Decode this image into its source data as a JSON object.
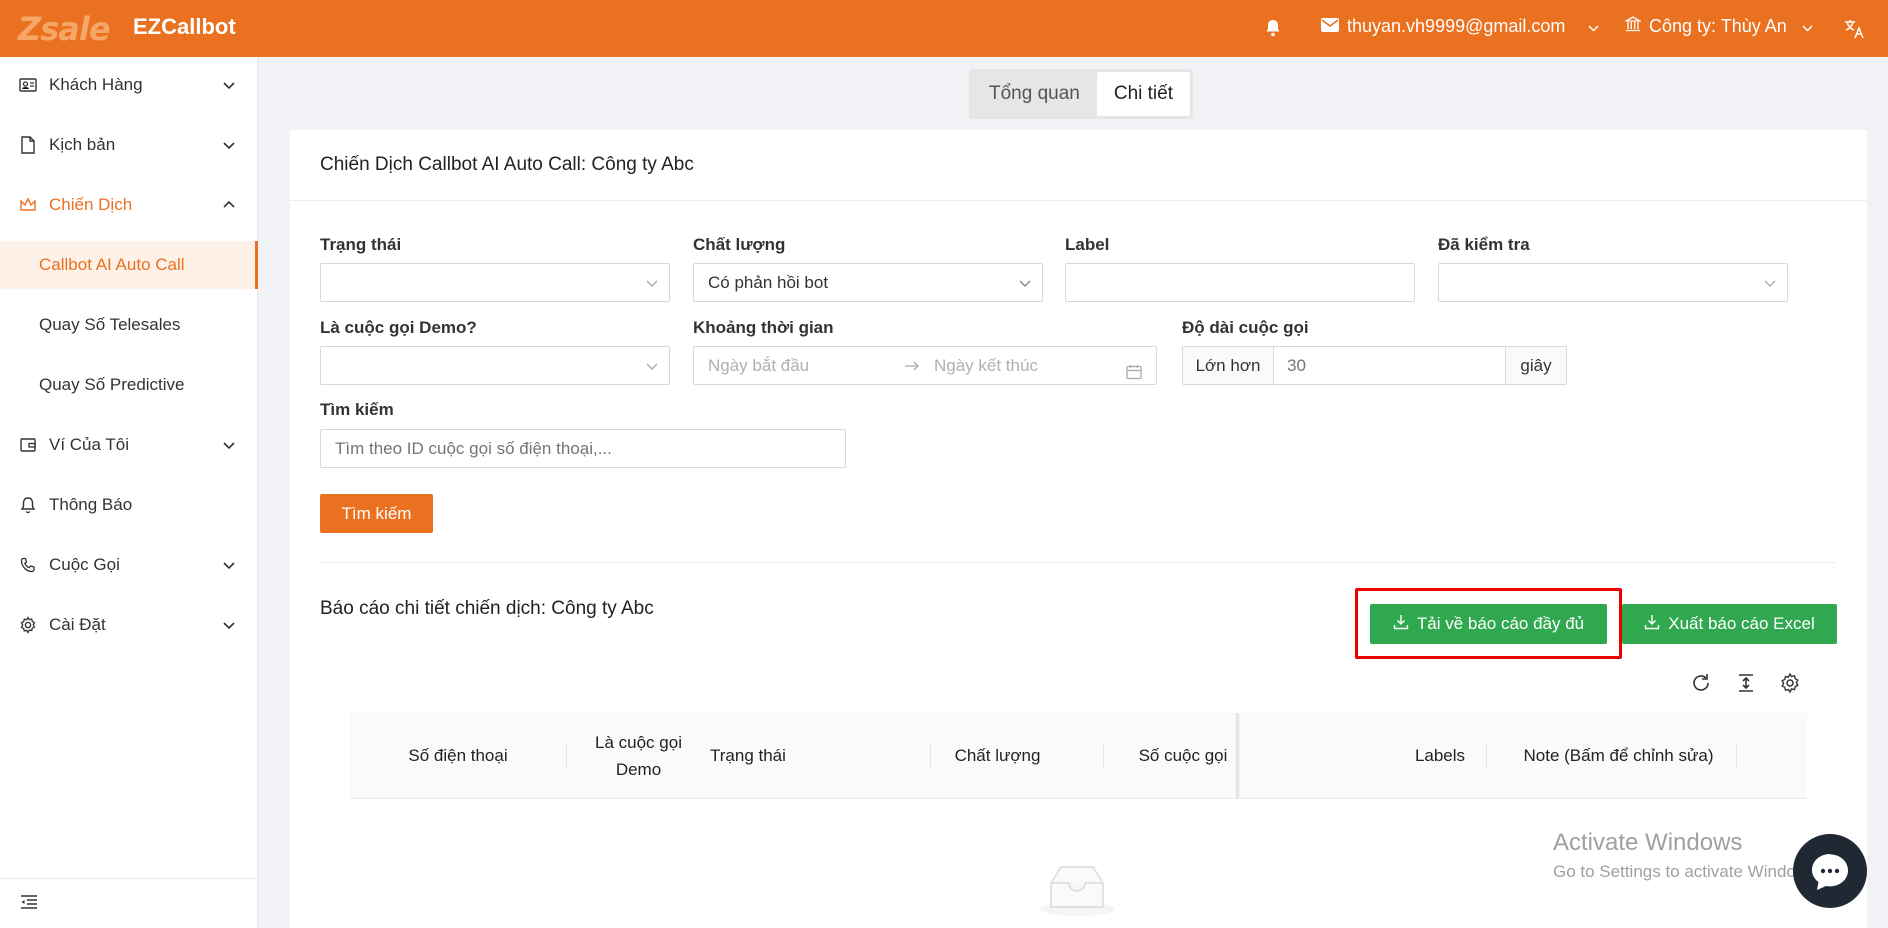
{
  "header": {
    "logo_text": "Zsale",
    "app_title": "EZCallbot",
    "user_email": "thuyan.vh9999@gmail.com",
    "company": "Công ty: Thùy An",
    "brand_color": "#ea7120"
  },
  "sidebar": {
    "items": [
      {
        "label": "Khách Hàng",
        "icon": "address-card-icon"
      },
      {
        "label": "Kịch bản",
        "icon": "file-icon"
      },
      {
        "label": "Chiến Dịch",
        "icon": "crown-icon"
      },
      {
        "label": "Callbot AI Auto Call"
      },
      {
        "label": "Quay Số Telesales"
      },
      {
        "label": "Quay Số Predictive"
      },
      {
        "label": "Ví Của Tôi",
        "icon": "wallet-icon"
      },
      {
        "label": "Thông Báo",
        "icon": "bell-icon"
      },
      {
        "label": "Cuộc Gọi",
        "icon": "phone-icon"
      },
      {
        "label": "Cài Đặt",
        "icon": "gear-icon"
      }
    ]
  },
  "tabs": [
    {
      "label": "Tổng quan"
    },
    {
      "label": "Chi tiết"
    }
  ],
  "card": {
    "title": "Chiến Dịch Callbot AI Auto Call: Công ty Abc"
  },
  "filters": {
    "status_label": "Trạng thái",
    "quality_label": "Chất lượng",
    "quality_value": "Có phản hồi bot",
    "label_label": "Label",
    "checked_label": "Đã kiểm tra",
    "demo_label": "Là cuộc gọi Demo?",
    "time_label": "Khoảng thời gian",
    "start_placeholder": "Ngày bắt đầu",
    "end_placeholder": "Ngày kết thúc",
    "duration_label": "Độ dài cuộc gọi",
    "duration_prefix": "Lớn hơn",
    "duration_placeholder": "30",
    "duration_suffix": "giây",
    "search_label": "Tìm kiếm",
    "search_placeholder": "Tìm theo ID cuộc gọi số điện thoại,...",
    "search_button": "Tìm kiếm"
  },
  "report": {
    "title": "Báo cáo chi tiết chiến dịch: Công ty Abc",
    "download_full": "Tải về báo cáo đầy đủ",
    "export_excel": "Xuất báo cáo Excel"
  },
  "table": {
    "columns": [
      "Số điện thoại",
      "Là cuộc gọi Demo",
      "Trạng thái",
      "Chất lượng",
      "Số cuộc gọi",
      "Labels",
      "Note (Bấm để chỉnh sửa)"
    ]
  },
  "watermark": {
    "line1": "Activate Windows",
    "line2": "Go to Settings to activate Windows."
  }
}
